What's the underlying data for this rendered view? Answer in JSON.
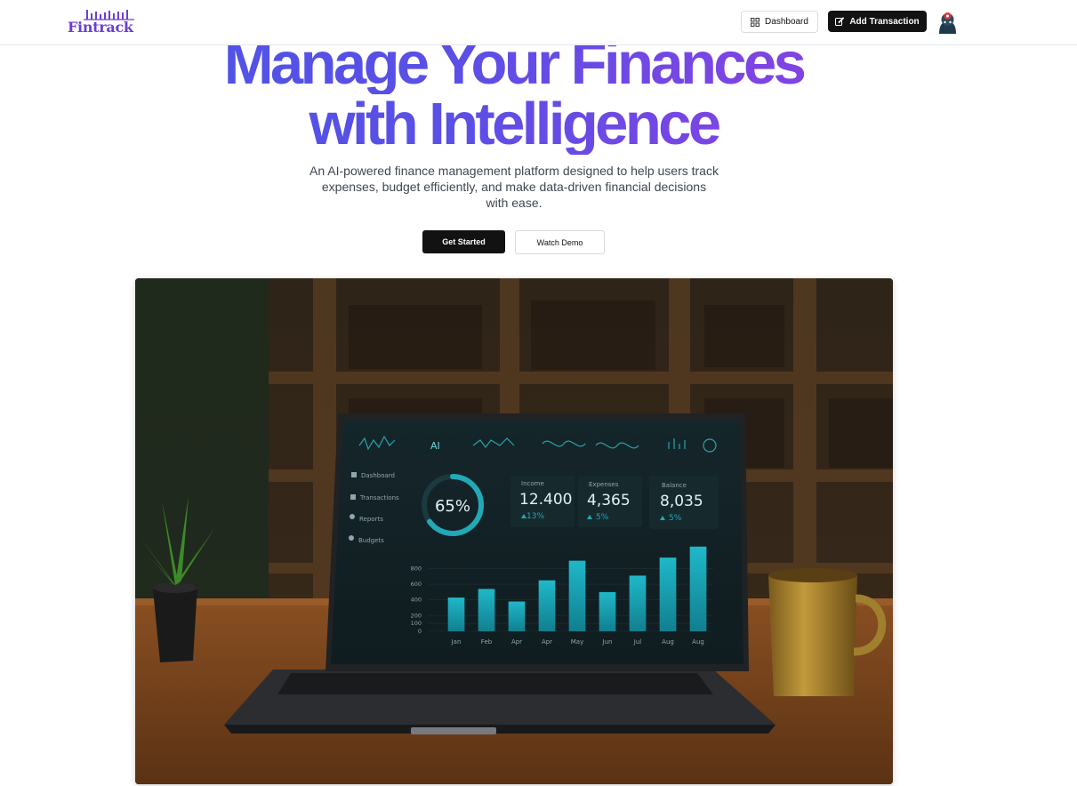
{
  "header": {
    "logo_text": "Fintrack",
    "dashboard_label": "Dashboard",
    "add_transaction_label": "Add Transaction"
  },
  "hero": {
    "title_line1": "Manage Your Finances",
    "title_line2": "with Intelligence",
    "subtitle": "An AI-powered finance management platform designed to help users track expenses, budget efficiently, and make data-driven financial decisions with ease.",
    "get_started_label": "Get Started",
    "watch_demo_label": "Watch Demo"
  },
  "screen": {
    "top_label": "AI",
    "nav": [
      "Dashboard",
      "Transactions",
      "Reports",
      "Budgets"
    ],
    "donut_value": "65%",
    "donut_fraction": 0.65,
    "stats": [
      {
        "label": "Income",
        "value": "12.400",
        "change": "13%"
      },
      {
        "label": "Expenses",
        "value": "4,365",
        "change": "5%"
      },
      {
        "label": "Balance",
        "value": "8,035",
        "change": "5%"
      }
    ]
  },
  "chart_data": {
    "type": "bar",
    "categories": [
      "Jan",
      "Feb",
      "Apr",
      "Apr",
      "May",
      "Jun",
      "Jul",
      "Aug",
      "Aug"
    ],
    "values": [
      430,
      540,
      380,
      650,
      900,
      500,
      710,
      940,
      1080
    ],
    "y_ticks": [
      "0",
      "100",
      "200",
      "400",
      "600",
      "800"
    ],
    "ylim": [
      0,
      1100
    ],
    "bar_color": "#17a6b8"
  },
  "colors": {
    "brand": "#6b3fd6",
    "title_gradient_start": "#4b55e8",
    "title_gradient_end": "#8f3fe0",
    "dark_button": "#121212"
  }
}
